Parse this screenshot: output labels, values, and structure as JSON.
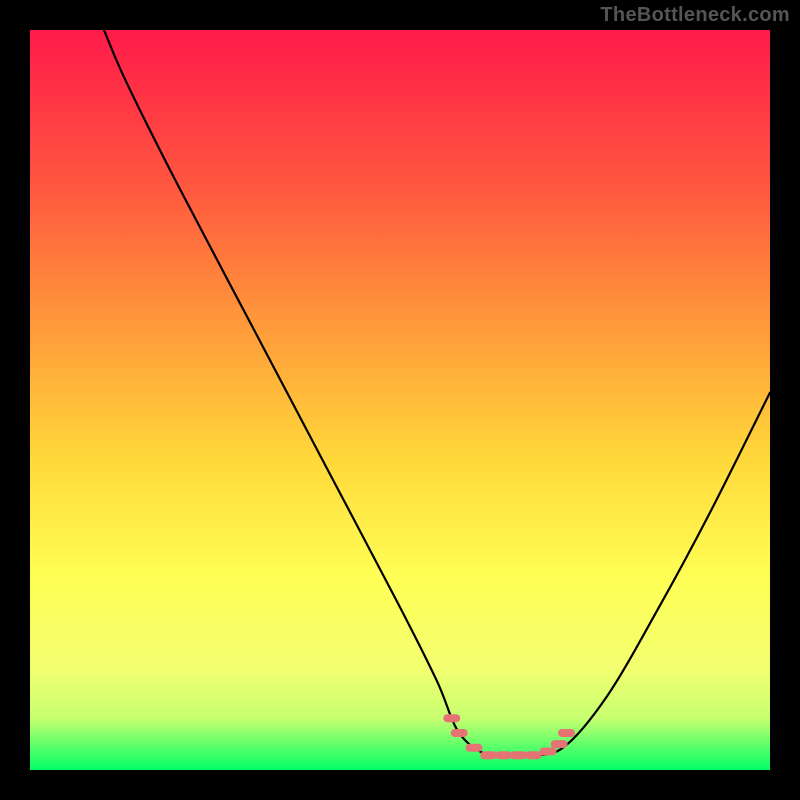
{
  "watermark": "TheBottleneck.com",
  "colors": {
    "bg": "#000000",
    "gradient_top": "#ff1a4a",
    "gradient_mid1": "#ff7a3a",
    "gradient_mid2": "#ffd83a",
    "gradient_mid3": "#ffff55",
    "gradient_mid4": "#e0ff70",
    "gradient_bottom": "#00ff66",
    "curve": "#000000",
    "marker": "#e57373"
  },
  "chart_data": {
    "type": "line",
    "title": "",
    "xlabel": "",
    "ylabel": "",
    "xlim": [
      0,
      100
    ],
    "ylim": [
      0,
      100
    ],
    "series": [
      {
        "name": "curve",
        "x": [
          10,
          13,
          20,
          30,
          40,
          50,
          55,
          58,
          62,
          67,
          72,
          78,
          85,
          92,
          100
        ],
        "y": [
          100,
          93,
          79,
          60,
          41,
          22,
          12,
          5,
          2,
          2,
          3,
          10,
          22,
          35,
          51
        ]
      }
    ],
    "markers": {
      "name": "highlight-band",
      "x": [
        57,
        58,
        60,
        62,
        64,
        66,
        68,
        70,
        71.5,
        72.5
      ],
      "y": [
        7,
        5,
        3,
        2,
        2,
        2,
        2,
        2.5,
        3.5,
        5
      ]
    }
  }
}
